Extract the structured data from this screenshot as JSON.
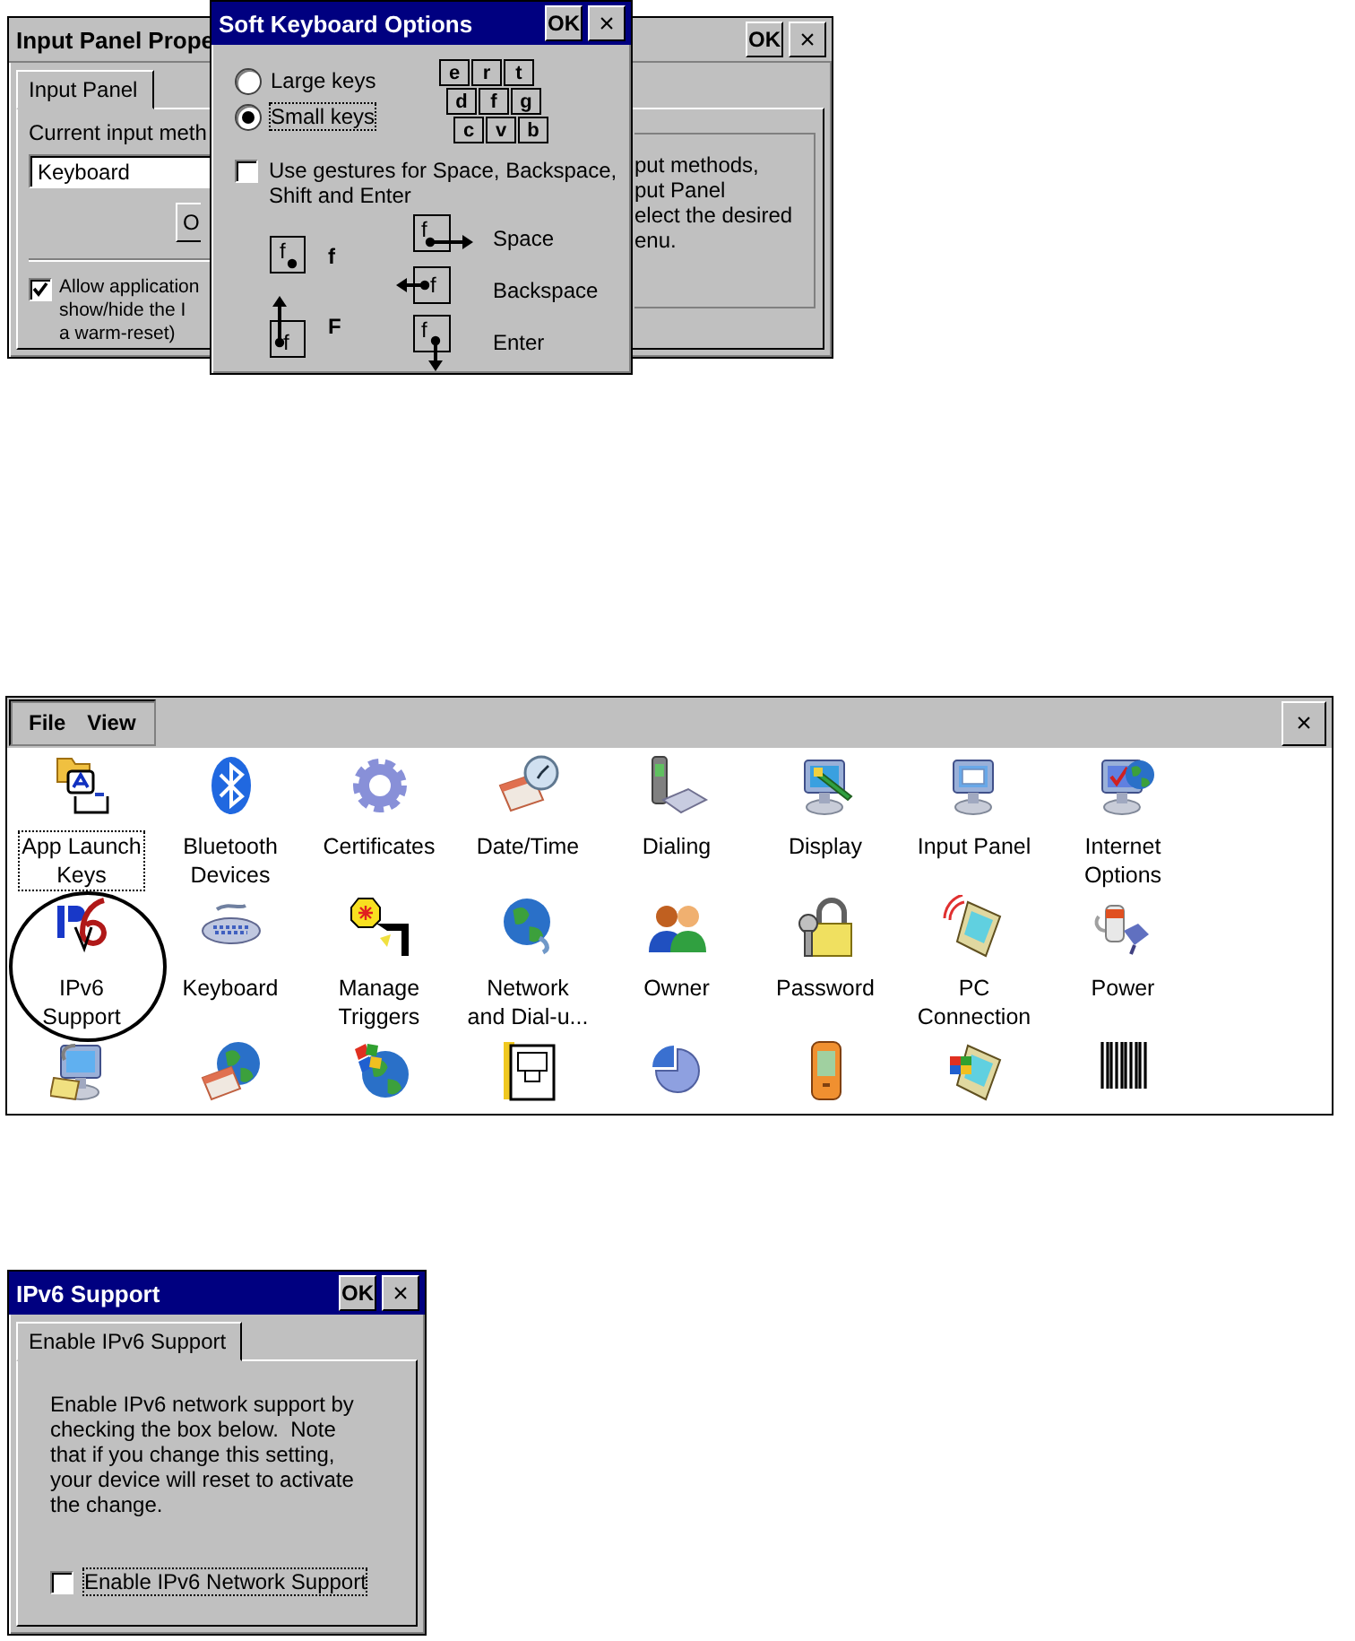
{
  "input_panel_window": {
    "title": "Input Panel Prope",
    "ok": "OK",
    "close": "×",
    "tabs": [
      {
        "label": "Input Panel",
        "selected": true
      }
    ],
    "method_label": "Current input meth",
    "method_value": "Keyboard",
    "options_button": "O",
    "info_lines": [
      "put methods,",
      "put Panel",
      "elect the desired",
      "enu."
    ],
    "allow_checkbox": {
      "checked": true,
      "lines": [
        "Allow application",
        "show/hide the I",
        "a warm-reset)"
      ]
    }
  },
  "soft_keyboard_dialog": {
    "title": "Soft Keyboard Options",
    "ok": "OK",
    "close": "×",
    "key_sizes": [
      {
        "label": "Large keys",
        "selected": false
      },
      {
        "label": "Small keys",
        "selected": true
      }
    ],
    "key_rows": [
      [
        "e",
        "r",
        "t"
      ],
      [
        "d",
        "f",
        "g"
      ],
      [
        "c",
        "v",
        "b"
      ]
    ],
    "gestures_checkbox": {
      "checked": false,
      "label": "Use gestures for Space, Backspace, Shift and Enter"
    },
    "gesture_columns": [
      [
        {
          "kind": "tap",
          "key": "f",
          "label": "f"
        },
        {
          "kind": "up",
          "key": "f",
          "label": "F"
        }
      ],
      [
        {
          "kind": "right",
          "key": "f",
          "label": "Space"
        },
        {
          "kind": "left",
          "key": "f",
          "label": "Backspace"
        },
        {
          "kind": "down",
          "key": "f",
          "label": "Enter"
        }
      ]
    ]
  },
  "control_panel": {
    "menu": [
      "File",
      "View"
    ],
    "close": "×",
    "items": [
      {
        "label": "App Launch\nKeys",
        "selected": true,
        "circled": false
      },
      {
        "label": "Bluetooth\nDevices",
        "selected": false,
        "circled": false
      },
      {
        "label": "Certificates",
        "selected": false,
        "circled": false
      },
      {
        "label": "Date/Time",
        "selected": false,
        "circled": false
      },
      {
        "label": "Dialing",
        "selected": false,
        "circled": false
      },
      {
        "label": "Display",
        "selected": false,
        "circled": false
      },
      {
        "label": "Input Panel",
        "selected": false,
        "circled": false
      },
      {
        "label": "Internet\nOptions",
        "selected": false,
        "circled": false
      },
      {
        "label": "IPv6\nSupport",
        "selected": false,
        "circled": true
      },
      {
        "label": "Keyboard",
        "selected": false,
        "circled": false
      },
      {
        "label": "Manage\nTriggers",
        "selected": false,
        "circled": false
      },
      {
        "label": "Network\nand Dial-u...",
        "selected": false,
        "circled": false
      },
      {
        "label": "Owner",
        "selected": false,
        "circled": false
      },
      {
        "label": "Password",
        "selected": false,
        "circled": false
      },
      {
        "label": "PC\nConnection",
        "selected": false,
        "circled": false
      },
      {
        "label": "Power",
        "selected": false,
        "circled": false
      },
      {
        "selected": false,
        "circled": false
      },
      {
        "selected": false,
        "circled": false
      },
      {
        "selected": false,
        "circled": false
      },
      {
        "selected": false,
        "circled": false
      },
      {
        "selected": false,
        "circled": false
      },
      {
        "selected": false,
        "circled": false
      },
      {
        "selected": false,
        "circled": false
      },
      {
        "selected": false,
        "circled": false
      }
    ]
  },
  "ipv6_dialog": {
    "title": "IPv6 Support",
    "ok": "OK",
    "close": "×",
    "tabs": [
      {
        "label": "Enable IPv6 Support",
        "selected": true
      }
    ],
    "description": "Enable IPv6 network support by\nchecking the box below.  Note\nthat if you change this setting,\nyour device will reset to activate\nthe change.",
    "checkbox": {
      "label": "Enable IPv6 Network Support",
      "checked": false,
      "focused": true
    }
  }
}
